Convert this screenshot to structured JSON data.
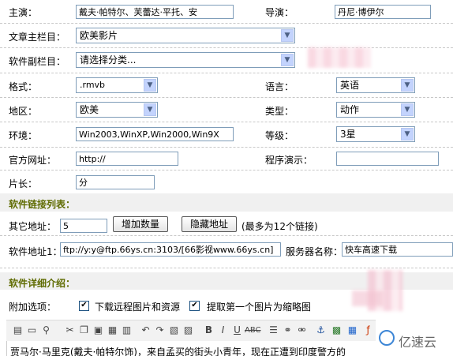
{
  "fields": {
    "actor_label": "主演：",
    "actor_value": "戴夫·帕特尔、芙蕾达·平托、安",
    "director_label": "导演：",
    "director_value": "丹尼·博伊尔",
    "main_column_label": "文章主栏目：",
    "main_column_value": "欧美影片",
    "sub_column_label": "软件副栏目：",
    "sub_column_value": "请选择分类...",
    "format_label": "格式：",
    "format_value": ".rmvb",
    "language_label": "语言：",
    "language_value": "英语",
    "region_label": "地区：",
    "region_value": "欧美",
    "type_label": "类型：",
    "type_value": "动作",
    "env_label": "环境：",
    "env_value": "Win2003,WinXP,Win2000,Win9X",
    "grade_label": "等级：",
    "grade_value": "3星",
    "website_label": "官方网址：",
    "website_value": "http://",
    "demo_label": "程序演示：",
    "demo_value": "",
    "length_label": "片长：",
    "length_value": "分"
  },
  "links": {
    "section_title": "软件链接列表：",
    "other_addr_label": "其它地址：",
    "other_addr_value": "5",
    "add_button": "增加数量",
    "hide_button": "隐藏地址",
    "max_note": "(最多为12个链接)",
    "soft_addr_label": "软件地址1：",
    "soft_addr_value": "ftp://y:y@ftp.66ys.cn:3103/[66影视www.66ys.cn]",
    "server_label": "服务器名称：",
    "server_value": "快车高速下载"
  },
  "details": {
    "section_title": "软件详细介绍：",
    "options_label": "附加选项：",
    "opt_download_remote": "下载远程图片和资源",
    "opt_download_checked": true,
    "opt_thumbnail": "提取第一个图片为缩略图",
    "opt_thumbnail_checked": true,
    "editor_text": "贾马尔·马里克(戴夫·帕特尔饰)，来自孟买的街头小青年，现在正遭到印度警方的"
  },
  "toolbar_icons": [
    "source-icon",
    "new-doc-icon",
    "preview-icon",
    "cut-icon",
    "copy-icon",
    "paste-icon",
    "paste-text-icon",
    "paste-word-icon",
    "bold-icon",
    "italic-icon",
    "underline-icon",
    "strike-icon",
    "link-icon",
    "unlink-icon",
    "anchor-icon",
    "image-icon",
    "flash-icon"
  ],
  "watermark": "亿速云",
  "colors": {
    "section_title": "#5f6b00",
    "section_bg": "#f0f0f0",
    "input_border": "#7f9db9"
  }
}
